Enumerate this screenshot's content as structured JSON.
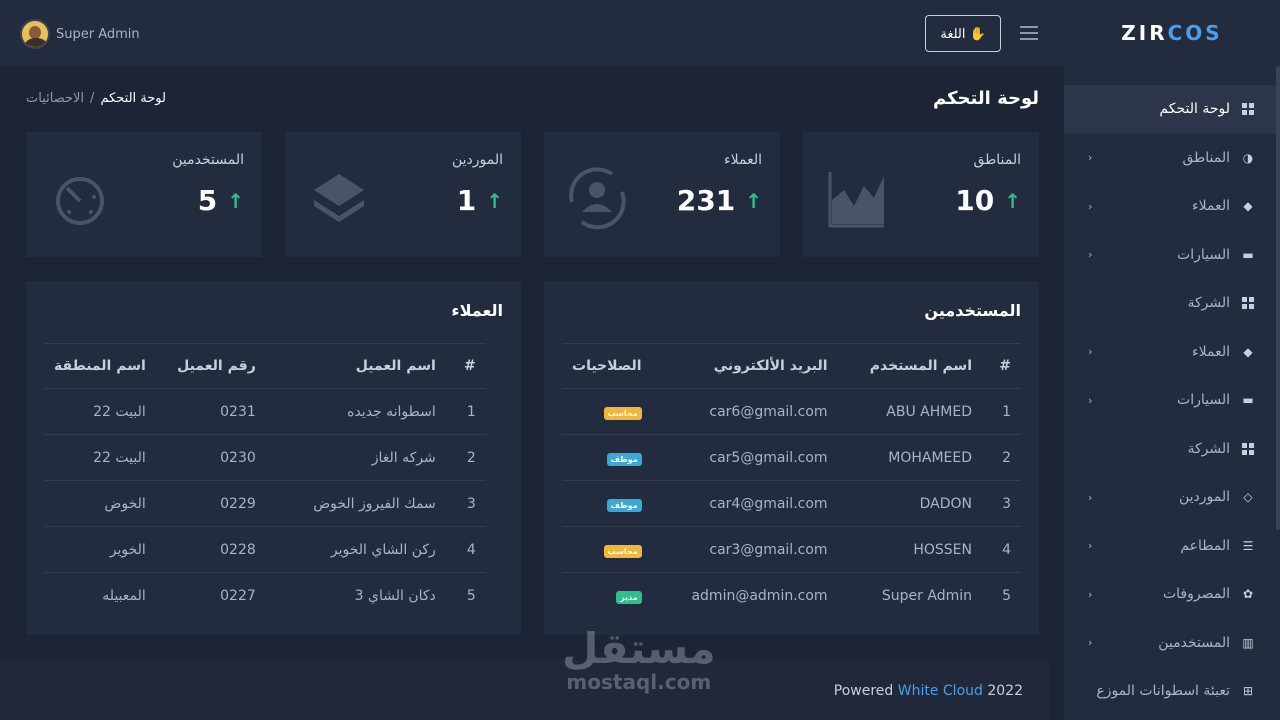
{
  "topbar": {
    "username": "Super Admin",
    "language_button": "اللغة",
    "hand_icon": "✋"
  },
  "sidebar": {
    "logo_main": "ZIR",
    "logo_accent": "COS",
    "items": [
      {
        "label": "لوحة التحكم",
        "icon": "dashboard-icon",
        "chevron": false
      },
      {
        "label": "المناطق",
        "icon": "contrast-icon",
        "chevron": true
      },
      {
        "label": "العملاء",
        "icon": "layers-icon",
        "chevron": true
      },
      {
        "label": "السيارات",
        "icon": "car-icon",
        "chevron": true
      },
      {
        "label": "الشركة",
        "icon": "dashboard-icon",
        "chevron": false
      },
      {
        "label": "العملاء",
        "icon": "layers-icon",
        "chevron": true
      },
      {
        "label": "السيارات",
        "icon": "car-icon",
        "chevron": true
      },
      {
        "label": "الشركة",
        "icon": "dashboard-icon",
        "chevron": false
      },
      {
        "label": "الموردين",
        "icon": "diamond-icon",
        "chevron": true
      },
      {
        "label": "المطاعم",
        "icon": "list-icon",
        "chevron": true
      },
      {
        "label": "المصروفات",
        "icon": "gear-icon",
        "chevron": true
      },
      {
        "label": "المستخدمين",
        "icon": "map-icon",
        "chevron": true
      },
      {
        "label": "تعبئة اسطوانات الموزع",
        "icon": "plus-box-icon",
        "chevron": false
      }
    ]
  },
  "header": {
    "title": "لوحة التحكم",
    "breadcrumb": [
      "الاحصائيات",
      "لوحة التحكم"
    ],
    "separator": "/"
  },
  "stats": [
    {
      "title": "المناطق",
      "value": "10",
      "icon": "area-chart-icon"
    },
    {
      "title": "العملاء",
      "value": "231",
      "icon": "user-rotate-icon"
    },
    {
      "title": "الموردين",
      "value": "1",
      "icon": "layers-icon"
    },
    {
      "title": "المستخدمين",
      "value": "5",
      "icon": "timer-icon"
    }
  ],
  "stat_arrow": "↑",
  "users_table": {
    "title": "المستخدمين",
    "columns": [
      "#",
      "اسم المستخدم",
      "البريد الألكتروني",
      "الصلاحيات"
    ],
    "rows": [
      {
        "num": "1",
        "name": "ABU AHMED",
        "email": "car6@gmail.com",
        "role": "محاسب",
        "role_color": "#f3b63a"
      },
      {
        "num": "2",
        "name": "MOHAMEED",
        "email": "car5@gmail.com",
        "role": "موظف",
        "role_color": "#3aa9d6"
      },
      {
        "num": "3",
        "name": "DADON",
        "email": "car4@gmail.com",
        "role": "موظف",
        "role_color": "#3aa9d6"
      },
      {
        "num": "4",
        "name": "HOSSEN",
        "email": "car3@gmail.com",
        "role": "محاسب",
        "role_color": "#f3b63a"
      },
      {
        "num": "5",
        "name": "Super Admin",
        "email": "admin@admin.com",
        "role": "مدير",
        "role_color": "#2ec08a"
      }
    ]
  },
  "clients_table": {
    "title": "العملاء",
    "columns": [
      "#",
      "اسم العميل",
      "رقم العميل",
      "اسم المنطقة"
    ],
    "rows": [
      {
        "num": "1",
        "name": "اسطوانه جديده",
        "code": "0231",
        "area": "البيت 22"
      },
      {
        "num": "2",
        "name": "شركه الغاز",
        "code": "0230",
        "area": "البيت 22"
      },
      {
        "num": "3",
        "name": "سمك الفيروز الخوض",
        "code": "0229",
        "area": "الخوض"
      },
      {
        "num": "4",
        "name": "ركن الشاي الخوير",
        "code": "0228",
        "area": "الخوير"
      },
      {
        "num": "5",
        "name": "دكان الشاي 3",
        "code": "0227",
        "area": "المعبيله"
      }
    ]
  },
  "footer": {
    "prefix": "Powered ",
    "link": "White Cloud",
    "year": " 2022"
  },
  "watermark": {
    "arabic": "مستقل",
    "latin": "mostaql.com"
  }
}
